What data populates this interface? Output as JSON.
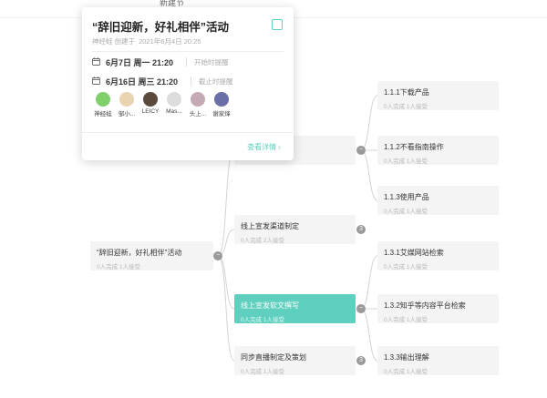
{
  "topbar": {
    "text": "新建节"
  },
  "popup": {
    "title": "“辞旧迎新，好礼相伴”活动",
    "creator": "神经蛙",
    "created_label": "创建于",
    "created_time": "2021年6月4日 20:25",
    "start": {
      "date": "6月7日 周一 21:20",
      "label": "开始时提醒"
    },
    "end": {
      "date": "6月16日 周三 21:20",
      "label": "截止时提醒"
    },
    "participants": [
      {
        "name": "神经蛙",
        "color": "#7fcf6a"
      },
      {
        "name": "邹小...",
        "color": "#e9d3b0"
      },
      {
        "name": "LEICY",
        "color": "#5a4a3e"
      },
      {
        "name": "Mas...",
        "color": "#dcdcdc"
      },
      {
        "name": "头上...",
        "color": "#c5a9b5"
      },
      {
        "name": "谢家烽",
        "color": "#6a6fa8"
      }
    ],
    "detail_link": "查看详情 ›"
  },
  "mindmap": {
    "root": {
      "title": "“辞旧迎新，好礼相伴”活动",
      "stats": "0人完成 1人接受"
    },
    "branches": [
      {
        "title": "",
        "stats": ""
      },
      {
        "title": "线上宣发渠道制定",
        "stats": "0人完成 2人接受",
        "badge": "3"
      },
      {
        "title": "线上宣发软文撰写",
        "stats": "0人完成 1人接受"
      },
      {
        "title": "同步直播制定及策划",
        "stats": "0人完成 1人接受",
        "badge": "3"
      }
    ],
    "leaves": [
      {
        "title": "1.1.1下载产品",
        "stats": "0人完成 1人接受"
      },
      {
        "title": "1.1.2不看指南操作",
        "stats": "0人完成 1人接受"
      },
      {
        "title": "1.1.3使用产品",
        "stats": "0人完成 1人接受"
      },
      {
        "title": "1.3.1艾媒网站检索",
        "stats": "0人完成 1人接受"
      },
      {
        "title": "1.3.2知乎等内容平台检索",
        "stats": "0人完成 1人接受"
      },
      {
        "title": "1.3.3输出理解",
        "stats": "0人完成 1人接受"
      }
    ]
  },
  "colors": {
    "accent": "#5fcfbf",
    "node_bg": "#f4f4f4",
    "toggle": "#9a9a9a"
  }
}
